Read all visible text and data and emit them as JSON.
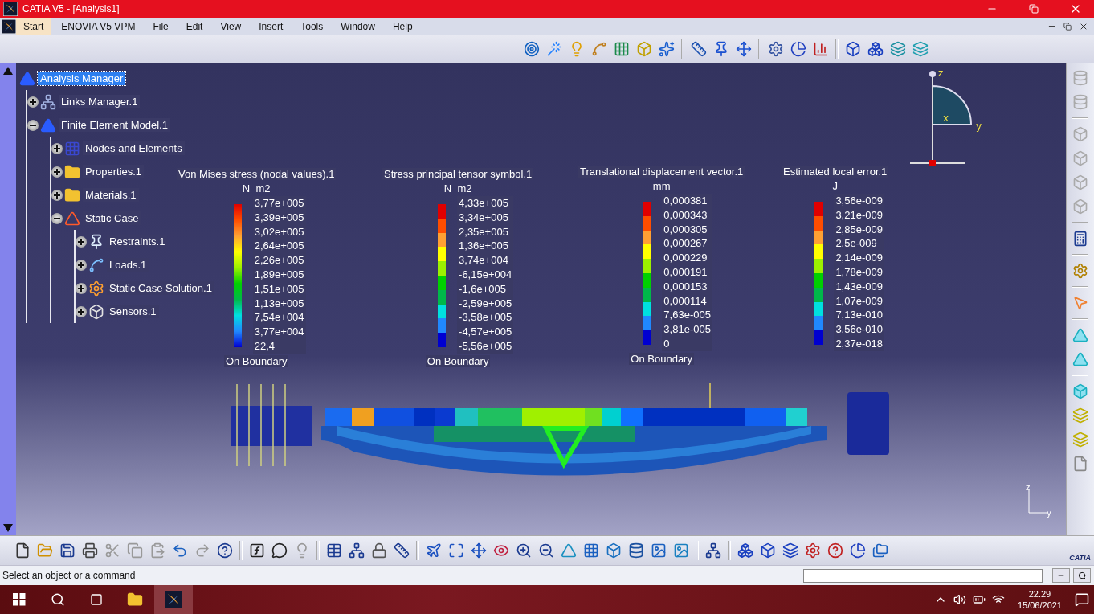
{
  "window": {
    "title": "CATIA V5 - [Analysis1]"
  },
  "menu": [
    {
      "label": "Start",
      "selected": true
    },
    {
      "label": "ENOVIA V5 VPM",
      "selected": false
    },
    {
      "label": "File",
      "selected": false
    },
    {
      "label": "Edit",
      "selected": false
    },
    {
      "label": "View",
      "selected": false
    },
    {
      "label": "Insert",
      "selected": false
    },
    {
      "label": "Tools",
      "selected": false
    },
    {
      "label": "Window",
      "selected": false
    },
    {
      "label": "Help",
      "selected": false
    }
  ],
  "tree": [
    {
      "label": "Analysis Manager",
      "selected": true,
      "current": false,
      "children": [
        {
          "label": "Links Manager.1",
          "selected": false,
          "current": false,
          "expanded": false
        },
        {
          "label": "Finite Element Model.1",
          "selected": false,
          "current": false,
          "expanded": true,
          "children": [
            {
              "label": "Nodes and Elements",
              "selected": false,
              "current": false,
              "expanded": false
            },
            {
              "label": "Properties.1",
              "selected": false,
              "current": false,
              "expanded": false
            },
            {
              "label": "Materials.1",
              "selected": false,
              "current": false,
              "expanded": false
            },
            {
              "label": "Static Case",
              "selected": false,
              "current": true,
              "expanded": true,
              "children": [
                {
                  "label": "Restraints.1",
                  "selected": false,
                  "current": false,
                  "expanded": false
                },
                {
                  "label": "Loads.1",
                  "selected": false,
                  "current": false,
                  "expanded": false
                },
                {
                  "label": "Static Case Solution.1",
                  "selected": false,
                  "current": false,
                  "expanded": false
                },
                {
                  "label": "Sensors.1",
                  "selected": false,
                  "current": false,
                  "expanded": false
                }
              ]
            }
          ]
        }
      ]
    }
  ],
  "legends": [
    {
      "kind": "gradient",
      "title": "Von Mises stress (nodal values).1",
      "unit": "N_m2",
      "values": [
        "3,77e+005",
        "3,39e+005",
        "3,02e+005",
        "2,64e+005",
        "2,26e+005",
        "1,89e+005",
        "1,51e+005",
        "1,13e+005",
        "7,54e+004",
        "3,77e+004",
        "22,4"
      ],
      "footer": "On Boundary"
    },
    {
      "kind": "segmented",
      "title": "Stress principal tensor symbol.1",
      "unit": "N_m2",
      "values": [
        "4,33e+005",
        "3,34e+005",
        "2,35e+005",
        "1,36e+005",
        "3,74e+004",
        "-6,15e+004",
        "-1,6e+005",
        "-2,59e+005",
        "-3,58e+005",
        "-4,57e+005",
        "-5,56e+005"
      ],
      "footer": "On Boundary"
    },
    {
      "kind": "segmented",
      "title": "Translational displacement vector.1",
      "unit": "mm",
      "values": [
        "0,000381",
        "0,000343",
        "0,000305",
        "0,000267",
        "0,000229",
        "0,000191",
        "0,000153",
        "0,000114",
        "7,63e-005",
        "3,81e-005",
        "0"
      ],
      "footer": "On Boundary"
    },
    {
      "kind": "segmented",
      "title": "Estimated local error.1",
      "unit": "J",
      "values": [
        "3,56e-009",
        "3,21e-009",
        "2,85e-009",
        "2,5e-009",
        "2,14e-009",
        "1,78e-009",
        "1,43e-009",
        "1,07e-009",
        "7,13e-010",
        "3,56e-010",
        "2,37e-018"
      ]
    }
  ],
  "compass": {
    "labels": [
      "z",
      "y",
      "x"
    ]
  },
  "mini_axis": {
    "labels": [
      "z",
      "y"
    ]
  },
  "logo": {
    "text": "CATIA"
  },
  "status_bar": {
    "message": "Select an object or a command"
  },
  "taskbar": {
    "time": "22.29",
    "date": "15/06/2021"
  }
}
